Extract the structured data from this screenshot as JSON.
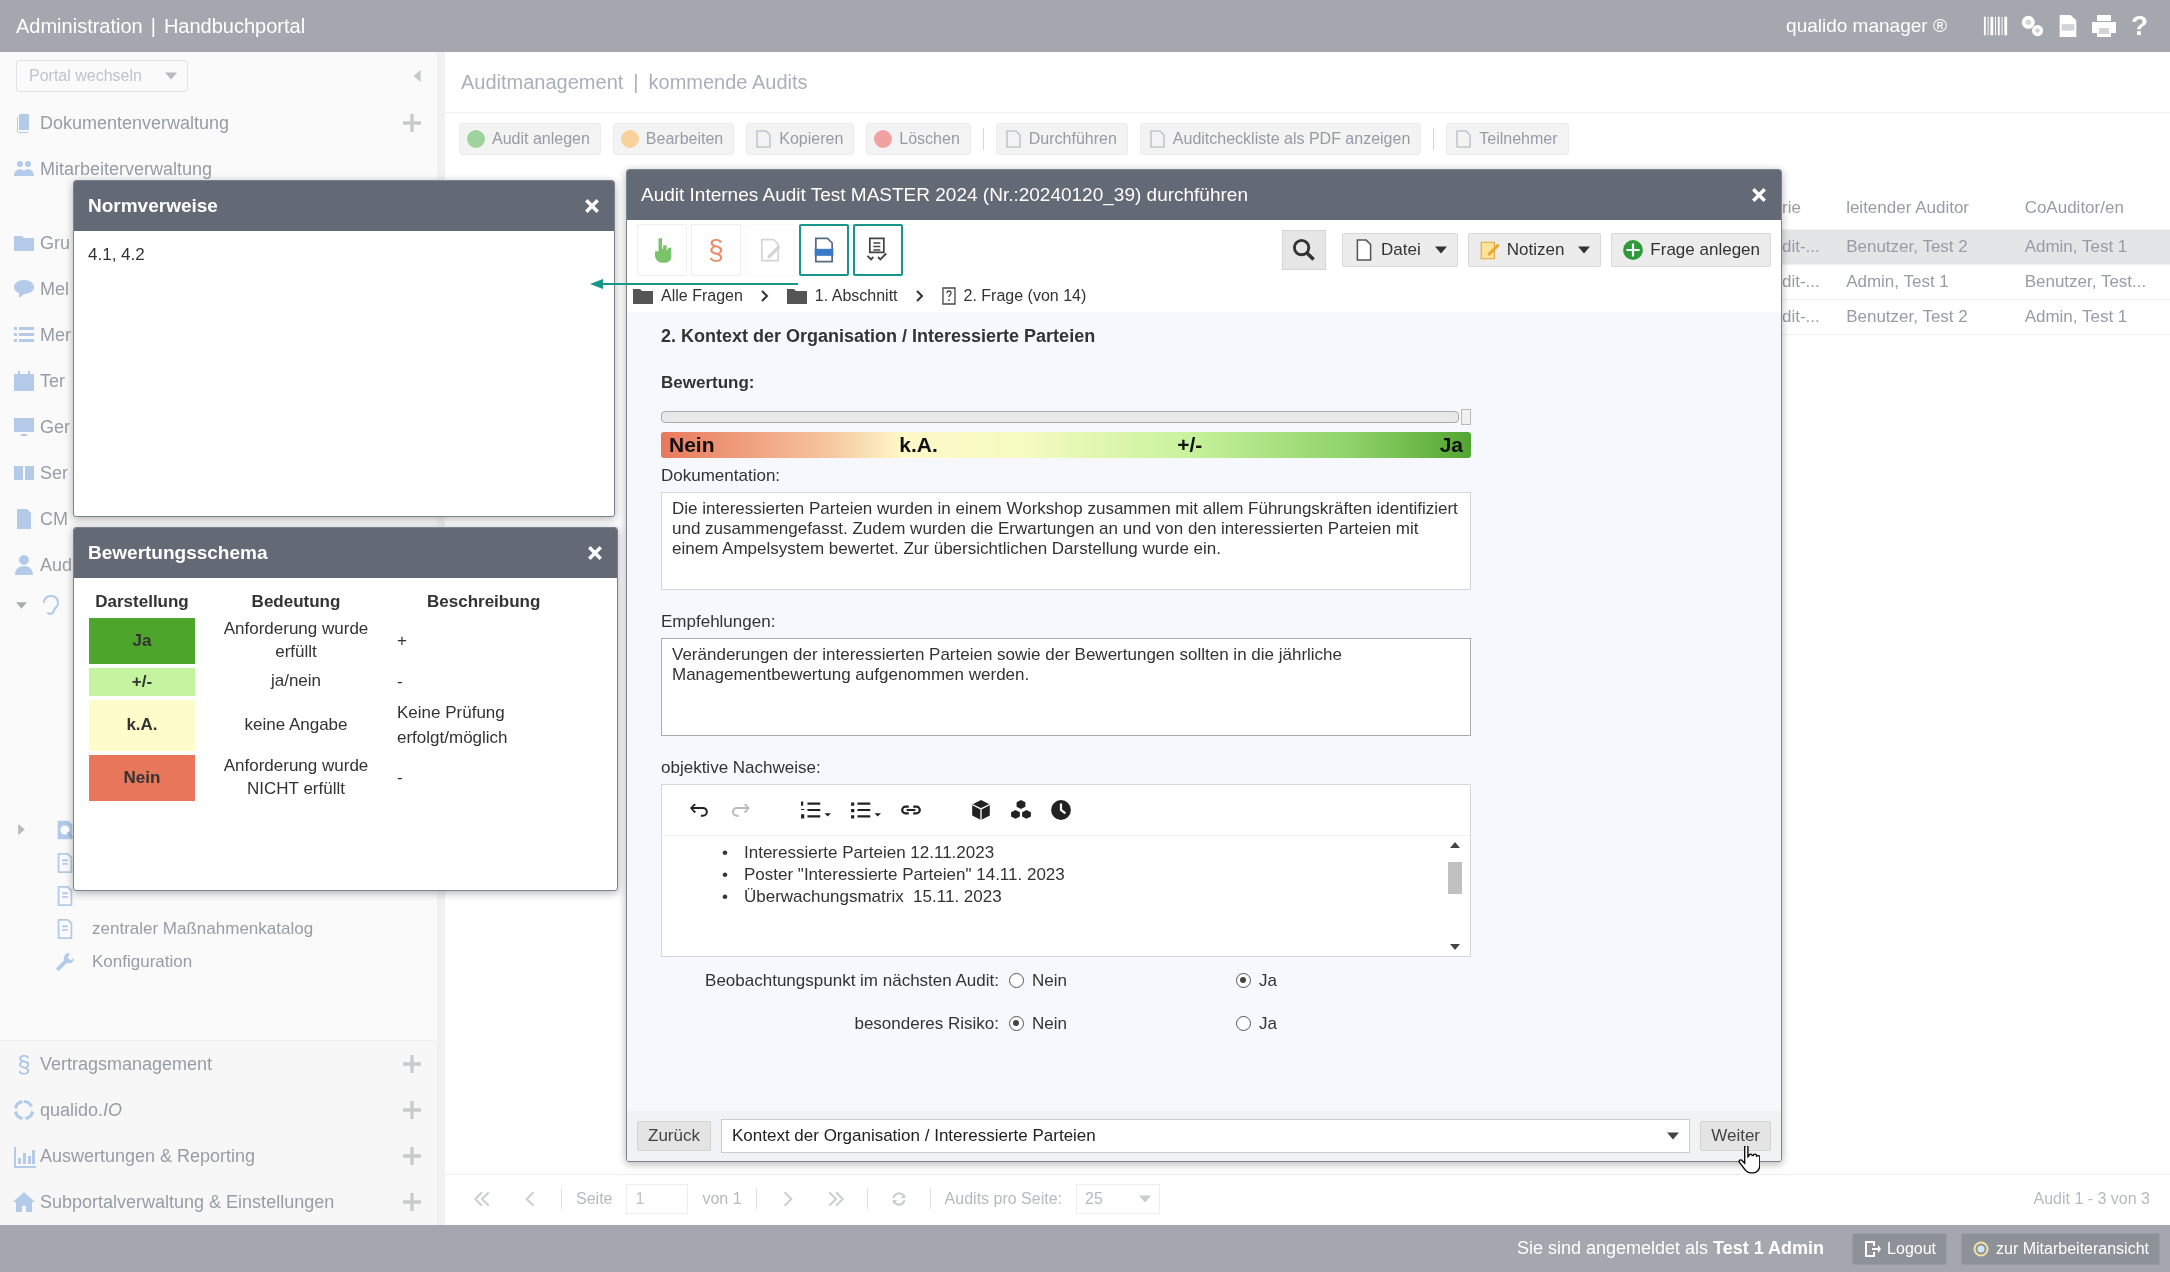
{
  "app_bar": {
    "title": "Administration",
    "separator": "|",
    "section": "Handbuchportal",
    "brand": "qualido manager ®",
    "help": "?"
  },
  "sidebar": {
    "portal_switch": "Portal wechseln",
    "modules": [
      {
        "label": "Dokumentenverwaltung",
        "addable": true
      },
      {
        "label": "Mitarbeiterverwaltung",
        "addable": false
      },
      {
        "label": "Gru"
      },
      {
        "label": "Mel"
      },
      {
        "label": "Mer"
      },
      {
        "label": "Ter"
      },
      {
        "label": "Ger"
      },
      {
        "label": "Ser"
      },
      {
        "label": "CM"
      },
      {
        "label": "Aud"
      }
    ],
    "open_module": {
      "expanded": true,
      "children": [
        {
          "kind": "group",
          "expanded": false
        },
        {
          "kind": "document"
        },
        {
          "kind": "document"
        },
        {
          "kind": "document",
          "label": "zentraler Maßnahmenkatalog"
        },
        {
          "kind": "tool",
          "label": "Konfiguration"
        }
      ]
    },
    "more_modules": [
      {
        "label": "Vertragsmanagement",
        "glyph": "§",
        "addable": true
      },
      {
        "label": "qualido.*IO*",
        "addable": true
      },
      {
        "label": "Auswertungen & Reporting",
        "addable": true
      },
      {
        "label": "Subportalverwaltung & Einstellungen",
        "addable": true
      }
    ]
  },
  "page": {
    "module": "Auditmanagement",
    "separator": "|",
    "view": "kommende Audits",
    "toolbar": [
      {
        "kind": "add",
        "label": "Audit anlegen"
      },
      {
        "kind": "edit",
        "label": "Bearbeiten"
      },
      {
        "kind": "copy",
        "label": "Kopieren"
      },
      {
        "kind": "delete",
        "label": "Löschen"
      },
      {
        "kind": "separator"
      },
      {
        "kind": "run",
        "label": "Durchführen"
      },
      {
        "kind": "pdf",
        "label": "Auditcheckliste als PDF anzeigen"
      },
      {
        "kind": "separator"
      },
      {
        "kind": "people",
        "label": "Teilnehmer"
      }
    ],
    "table": {
      "columns": [
        "rie",
        "leitender Auditor",
        "CoAuditor/en"
      ],
      "rows": [
        {
          "selected": true,
          "cells": [
            "dit-...",
            "Benutzer, Test 2",
            "Admin, Test 1"
          ]
        },
        {
          "selected": false,
          "cells": [
            "dit-...",
            "Admin, Test 1",
            "Benutzer, Test..."
          ]
        },
        {
          "selected": false,
          "cells": [
            "dit-...",
            "Benutzer, Test 2",
            "Admin, Test 1"
          ]
        }
      ]
    },
    "pagination": {
      "page_label": "Seite",
      "page": "1",
      "of": "von 1",
      "per_page_label": "Audits pro Seite:",
      "per_page": "25",
      "summary": "Audit 1 - 3 von 3"
    }
  },
  "audit_dialog": {
    "title": "Audit Internes Audit Test MASTER 2024 (Nr.:20240120_39) durchführen",
    "tools": [
      {
        "kind": "hand",
        "highlighted": false,
        "disabled": false
      },
      {
        "kind": "paragraph",
        "glyph": "§",
        "highlighted": false,
        "disabled": false
      },
      {
        "kind": "edit",
        "highlighted": false,
        "disabled": true
      },
      {
        "kind": "iso",
        "highlighted": true,
        "disabled": false
      },
      {
        "kind": "checklist",
        "highlighted": true,
        "disabled": false
      }
    ],
    "actions": [
      {
        "kind": "search"
      },
      {
        "kind": "file",
        "label": "Datei"
      },
      {
        "kind": "notes",
        "label": "Notizen"
      },
      {
        "kind": "add",
        "label": "Frage anlegen"
      }
    ],
    "breadcrumb": [
      {
        "kind": "folder",
        "label": "Alle Fragen"
      },
      {
        "kind": "folder",
        "label": "1. Abschnitt"
      },
      {
        "kind": "question",
        "label": "2. Frage (von 14)"
      }
    ],
    "question": "2. Kontext der Organisation / Interessierte Parteien",
    "rating": {
      "label": "Bewertung:",
      "level": 1,
      "scale": [
        "Nein",
        "k.A.",
        "+/-",
        "Ja"
      ]
    },
    "documentation": {
      "label": "Dokumentation:",
      "value": "Die interessierten Parteien wurden in einem Workshop zusammen mit allem Führungskräften identifiziert und zusammengefasst. Zudem wurden die Erwartungen an und von den interessierten Parteien mit einem Ampelsystem bewertet. Zur übersichtlichen Darstellung wurde ein."
    },
    "recommendations": {
      "label": "Empfehlungen:",
      "value": "Veränderungen der interessierten Parteien sowie der Bewertungen sollten in die jährliche Managementbewertung aufgenommen werden."
    },
    "evidence": {
      "label": "objektive Nachweise:",
      "marker": "•",
      "items": [
        "Interessierte Parteien 12.11.2023",
        "Poster \"Interessierte Parteien\" 14.11. 2023",
        "Überwachungsmatrix  15.11. 2023"
      ]
    },
    "options": [
      {
        "label": "Beobachtungspunkt im nächsten Audit:",
        "choices": [
          {
            "label": "Nein",
            "selected": false
          },
          {
            "label": "Ja",
            "selected": true
          }
        ]
      },
      {
        "label": "besonderes Risiko:",
        "choices": [
          {
            "label": "Nein",
            "selected": true
          },
          {
            "label": "Ja",
            "selected": false
          }
        ]
      }
    ],
    "back": "Zurück",
    "section": "Kontext der Organisation / Interessierte Parteien",
    "next": "Weiter"
  },
  "norm_dialog": {
    "title": "Normverweise",
    "content": "4.1, 4.2"
  },
  "scheme_dialog": {
    "title": "Bewertungsschema",
    "columns": [
      "Darstellung",
      "Bedeutung",
      "Beschreibung"
    ],
    "rows": [
      {
        "label": "Ja",
        "color": "#4ea52c",
        "meaning": "Anforderung wurde erfüllt",
        "description": "+"
      },
      {
        "label": "+/-",
        "color": "#c4f4a0",
        "meaning": "ja/nein",
        "description": "-"
      },
      {
        "label": "k.A.",
        "color": "#fffccc",
        "meaning": "keine Angabe",
        "description": "Keine Prüfung erfolgt/möglich"
      },
      {
        "label": "Nein",
        "color": "#e7765a",
        "meaning": "Anforderung wurde NICHT erfüllt",
        "description": "-"
      }
    ]
  },
  "footer": {
    "session": "Sie sind angemeldet als **Test 1 Admin**",
    "logout": "Logout",
    "switch_view": "zur Mitarbeiteransicht"
  }
}
